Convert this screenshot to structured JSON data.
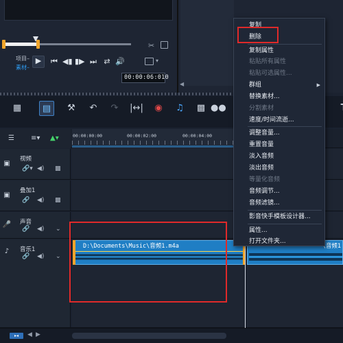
{
  "player": {
    "mode_project": "项目–",
    "mode_clip": "素材–",
    "timecode": "00:00:06:010"
  },
  "toolbar": {
    "t_label": "T"
  },
  "ruler": {
    "ticks": [
      "00:00:00:00",
      "00:00:02:00",
      "00:00:04:00"
    ]
  },
  "tracks": [
    {
      "name": "视频",
      "icon": "video-track-icon"
    },
    {
      "name": "叠加1",
      "icon": "overlay-track-icon"
    },
    {
      "name": "声音",
      "icon": "voice-track-icon"
    },
    {
      "name": "音乐1",
      "icon": "music-track-icon"
    }
  ],
  "clip": {
    "label": "D:\\Documents\\Music\\音频1.m4a",
    "next_label": "\\音频1"
  },
  "bottombar": {
    "left_badge": "▸◂"
  },
  "context_menu": {
    "items": [
      {
        "label": "复制",
        "enabled": true
      },
      {
        "label": "删除",
        "enabled": true
      },
      {
        "label": "复制属性",
        "enabled": true
      },
      {
        "label": "粘贴所有属性",
        "enabled": false
      },
      {
        "label": "粘贴可选属性...",
        "enabled": false
      },
      {
        "label": "群组",
        "enabled": true
      },
      {
        "label": "替换素材...",
        "enabled": true
      },
      {
        "label": "分割素材",
        "enabled": false
      },
      {
        "label": "速度/时间流逝...",
        "enabled": true
      },
      {
        "label": "调整音量...",
        "enabled": true
      },
      {
        "label": "重置音量",
        "enabled": true
      },
      {
        "label": "淡入音频",
        "enabled": true
      },
      {
        "label": "淡出音频",
        "enabled": true
      },
      {
        "label": "等量化音频",
        "enabled": false
      },
      {
        "label": "音频调节...",
        "enabled": true
      },
      {
        "label": "音频滤镜...",
        "enabled": true
      },
      {
        "label": "影音快手模板设计器...",
        "enabled": true
      },
      {
        "label": "属性...",
        "enabled": true
      },
      {
        "label": "打开文件夹...",
        "enabled": true
      }
    ]
  },
  "colors": {
    "accent": "#2e9ef5",
    "highlight": "#e02a2a",
    "trim": "#f0a52b"
  }
}
